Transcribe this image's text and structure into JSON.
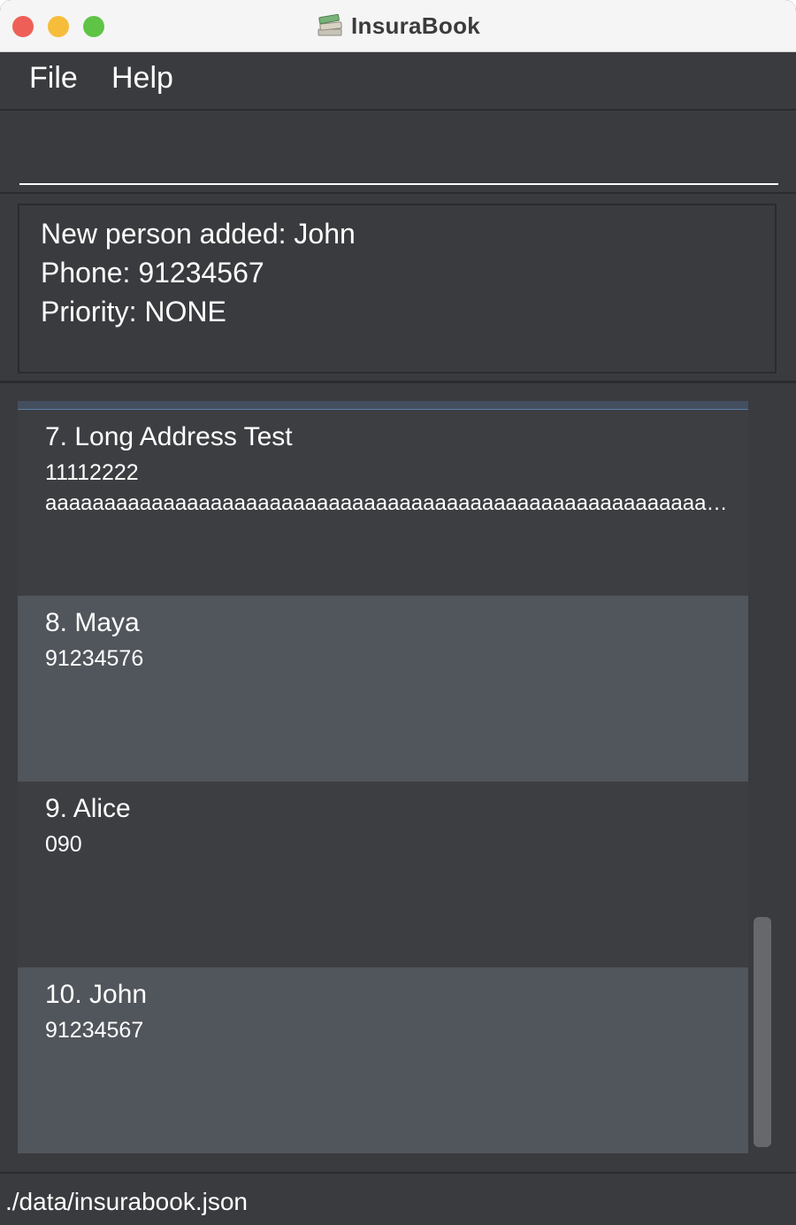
{
  "window": {
    "title": "InsuraBook",
    "icon": "books-icon"
  },
  "menu": {
    "file_label": "File",
    "help_label": "Help"
  },
  "command": {
    "value": "",
    "placeholder": ""
  },
  "result": {
    "line1": "New person added: John",
    "line2": "Phone: 91234567",
    "line3": "Priority: NONE"
  },
  "persons": [
    {
      "name": "7. Long Address Test",
      "phone": "11112222",
      "address": "aaaaaaaaaaaaaaaaaaaaaaaaaaaaaaaaaaaaaaaaaaaaaaaaaaaaaaaaaaa..."
    },
    {
      "name": "8. Maya",
      "phone": "91234576"
    },
    {
      "name": "9. Alice",
      "phone": "090"
    },
    {
      "name": "10. John",
      "phone": "91234567"
    }
  ],
  "status": {
    "file_path": "./data/insurabook.json"
  },
  "colors": {
    "background": "#3a3b3e",
    "card_dark": "#3c3e41",
    "card_light": "#50565b",
    "close": "#ee5f57",
    "minimize": "#f6bd3a",
    "maximize": "#5fc445"
  }
}
